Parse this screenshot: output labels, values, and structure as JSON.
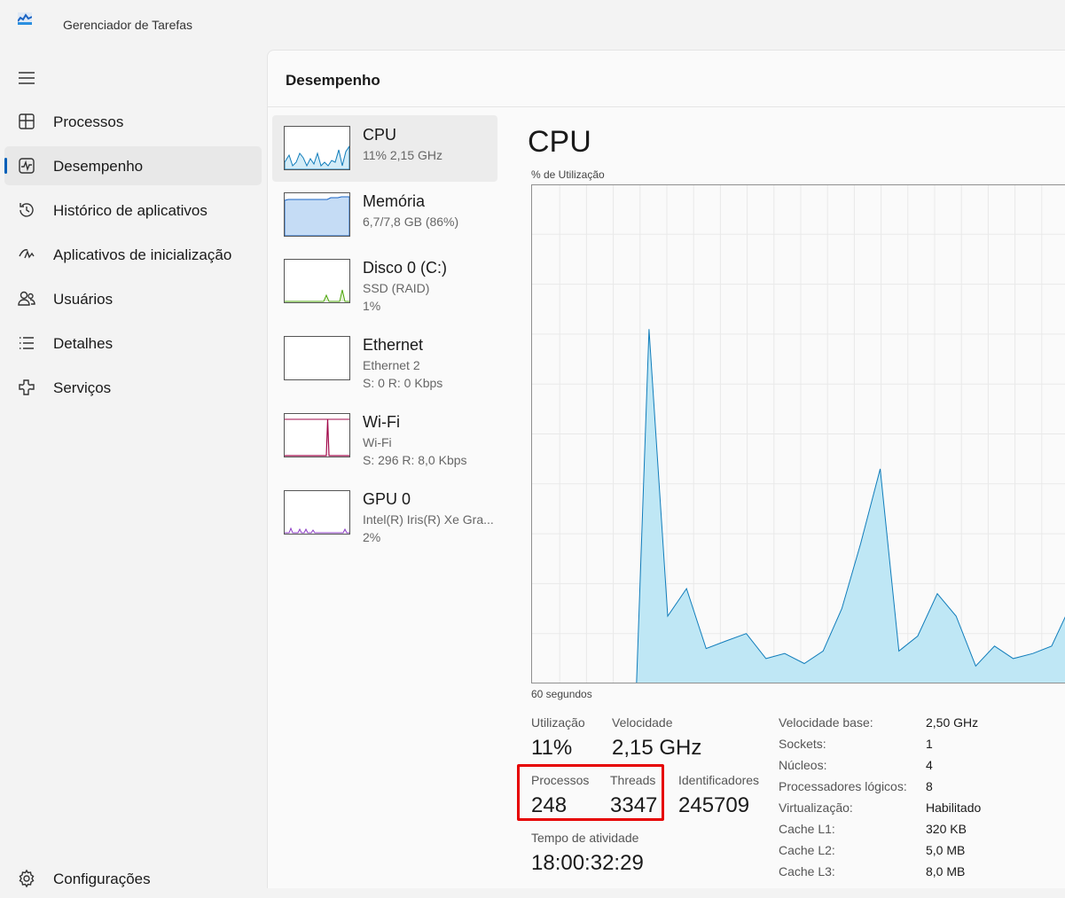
{
  "app": {
    "title": "Gerenciador de Tarefas",
    "accent": "#005fb8"
  },
  "sidebar": {
    "items": [
      {
        "label": "Processos",
        "icon": "processes-icon"
      },
      {
        "label": "Desempenho",
        "icon": "performance-icon",
        "active": true
      },
      {
        "label": "Histórico de aplicativos",
        "icon": "history-icon"
      },
      {
        "label": "Aplicativos de inicialização",
        "icon": "startup-icon"
      },
      {
        "label": "Usuários",
        "icon": "users-icon"
      },
      {
        "label": "Detalhes",
        "icon": "details-icon"
      },
      {
        "label": "Serviços",
        "icon": "services-icon"
      }
    ],
    "settings_label": "Configurações"
  },
  "panel": {
    "title": "Desempenho"
  },
  "resources": [
    {
      "name": "CPU",
      "sub1": "11% 2,15 GHz",
      "sub2": "",
      "color": "#117dbb",
      "active": true
    },
    {
      "name": "Memória",
      "sub1": "6,7/7,8 GB (86%)",
      "sub2": "",
      "color": "#1a64c4"
    },
    {
      "name": "Disco 0 (C:)",
      "sub1": "SSD (RAID)",
      "sub2": "1%",
      "color": "#4da60c"
    },
    {
      "name": "Ethernet",
      "sub1": "Ethernet 2",
      "sub2": "S: 0 R: 0 Kbps",
      "color": "#a74f01"
    },
    {
      "name": "Wi-Fi",
      "sub1": "Wi-Fi",
      "sub2": "S: 296 R: 8,0 Kbps",
      "color": "#a1094a"
    },
    {
      "name": "GPU 0",
      "sub1": "Intel(R) Iris(R) Xe Gra...",
      "sub2": "2%",
      "color": "#8e3dc6"
    }
  ],
  "cpu": {
    "title": "CPU",
    "graph_label": "% de Utilização",
    "time_label": "60 segundos",
    "stats": {
      "utilizacao_label": "Utilização",
      "utilizacao": "11%",
      "velocidade_label": "Velocidade",
      "velocidade": "2,15 GHz",
      "processos_label": "Processos",
      "processos": "248",
      "threads_label": "Threads",
      "threads": "3347",
      "identificadores_label": "Identificadores",
      "identificadores": "245709",
      "tempo_label": "Tempo de atividade",
      "tempo": "18:00:32:29"
    },
    "specs": [
      {
        "label": "Velocidade base:",
        "value": "2,50 GHz"
      },
      {
        "label": "Sockets:",
        "value": "1"
      },
      {
        "label": "Núcleos:",
        "value": "4"
      },
      {
        "label": "Processadores lógicos:",
        "value": "8"
      },
      {
        "label": "Virtualização:",
        "value": "Habilitado"
      },
      {
        "label": "Cache L1:",
        "value": "320 KB"
      },
      {
        "label": "Cache L2:",
        "value": "5,0 MB"
      },
      {
        "label": "Cache L3:",
        "value": "8,0 MB"
      }
    ]
  },
  "chart_data": {
    "type": "area",
    "xlim": [
      0,
      60
    ],
    "ylim": [
      0,
      100
    ],
    "grid": true,
    "line_color": "#117dbb",
    "fill_color": "#bfe7f5",
    "x": [
      0,
      2.9,
      5.9,
      8.8,
      11.8,
      13.2,
      15.3,
      17.4,
      19.6,
      21.8,
      24.1,
      26.3,
      28.4,
      30.6,
      32.7,
      34.8,
      36.9,
      39.1,
      41.2,
      43.3,
      45.5,
      47.6,
      49.8,
      51.9,
      54.0,
      56.2,
      58.3,
      60.0
    ],
    "values": [
      0,
      0,
      0,
      0,
      0,
      71,
      13.5,
      19,
      7,
      8.5,
      10,
      5,
      6,
      4,
      6.5,
      15,
      28,
      43,
      6.5,
      9.5,
      18,
      13.5,
      3.5,
      7.5,
      5,
      6,
      7.5,
      14
    ]
  }
}
